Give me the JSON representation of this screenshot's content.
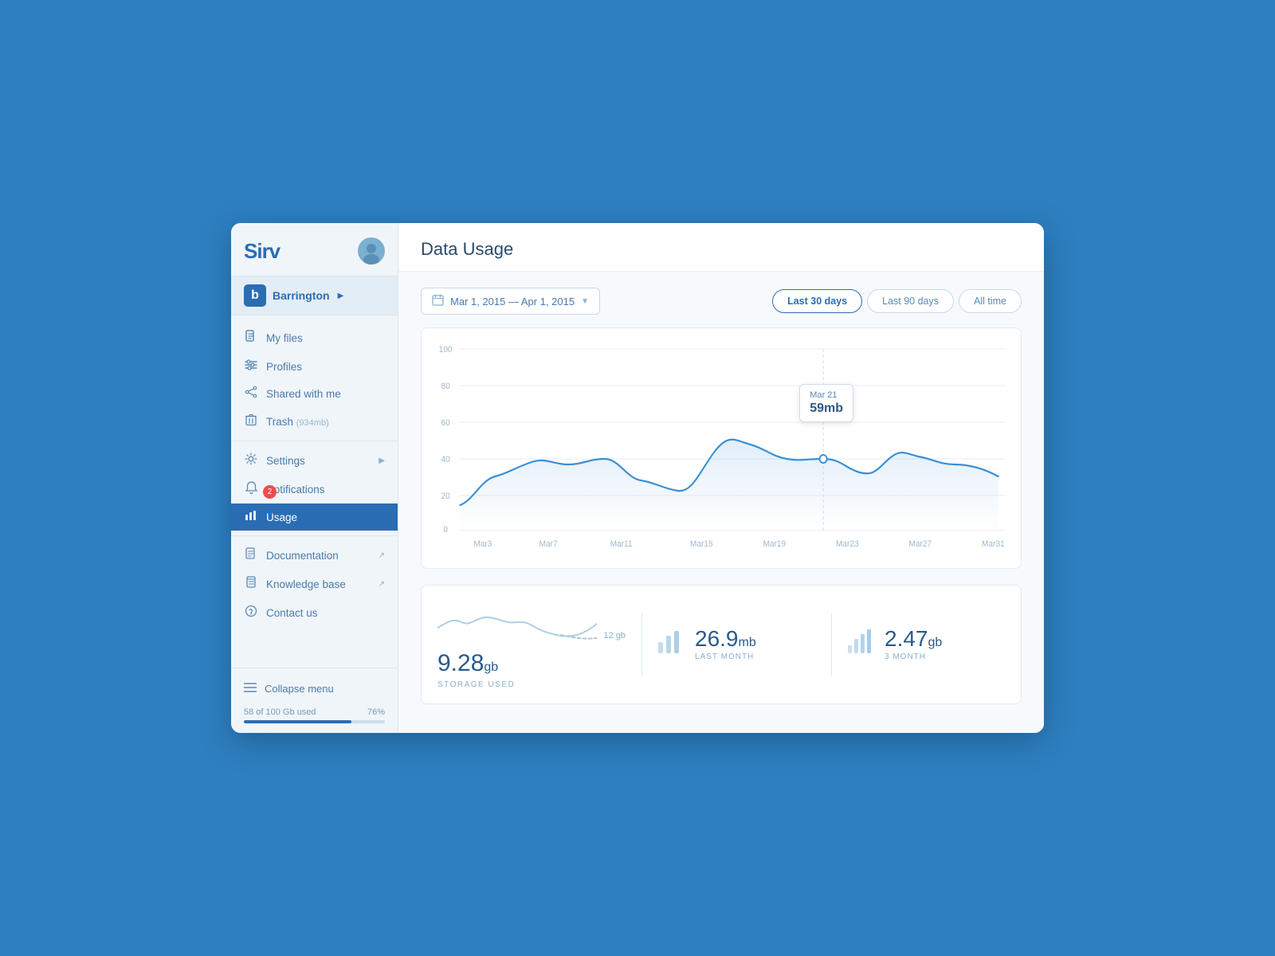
{
  "app": {
    "logo": "Sirv",
    "title": "Data Usage"
  },
  "sidebar": {
    "account": {
      "name": "Barrington",
      "arrow": "▶",
      "icon_letter": "b"
    },
    "nav_items": [
      {
        "id": "my-files",
        "label": "My files",
        "icon": "file",
        "active": false,
        "badge": null,
        "external": false
      },
      {
        "id": "profiles",
        "label": "Profiles",
        "icon": "sliders",
        "active": false,
        "badge": null,
        "external": false
      },
      {
        "id": "shared-with-me",
        "label": "Shared with me",
        "icon": "share",
        "active": false,
        "badge": null,
        "external": false
      },
      {
        "id": "trash",
        "label": "Trash",
        "icon": "trash",
        "active": false,
        "badge": null,
        "extra": "(934mb)",
        "external": false
      },
      {
        "id": "settings",
        "label": "Settings",
        "icon": "gear",
        "active": false,
        "badge": null,
        "arrow": "▶",
        "external": false
      },
      {
        "id": "notifications",
        "label": "Notifications",
        "icon": "bell",
        "active": false,
        "badge": "2",
        "external": false
      },
      {
        "id": "usage",
        "label": "Usage",
        "icon": "chart",
        "active": true,
        "badge": null,
        "external": false
      },
      {
        "id": "documentation",
        "label": "Documentation",
        "icon": "doc",
        "active": false,
        "badge": null,
        "external": true
      },
      {
        "id": "knowledge-base",
        "label": "Knowledge base",
        "icon": "book",
        "active": false,
        "badge": null,
        "external": true
      },
      {
        "id": "contact-us",
        "label": "Contact us",
        "icon": "help",
        "active": false,
        "badge": null,
        "external": false
      }
    ],
    "collapse_label": "Collapse menu",
    "storage": {
      "used_text": "58 of 100 Gb used",
      "percent_text": "76%",
      "percent": 76
    }
  },
  "controls": {
    "date_range": "Mar 1, 2015 — Apr 1, 2015",
    "period_buttons": [
      {
        "label": "Last 30 days",
        "active": true
      },
      {
        "label": "Last 90 days",
        "active": false
      },
      {
        "label": "All time",
        "active": false
      }
    ]
  },
  "chart": {
    "y_labels": [
      "100",
      "80",
      "60",
      "40",
      "20",
      "0"
    ],
    "x_labels": [
      "Mar3",
      "Mar7",
      "Mar11",
      "Mar15",
      "Mar19",
      "Mar23",
      "Mar27",
      "Mar31"
    ],
    "tooltip": {
      "date": "Mar 21",
      "value": "59mb"
    }
  },
  "stats": {
    "storage_used": "9.28",
    "storage_unit": "gb",
    "storage_label": "STORAGE USED",
    "sparkline_limit": "12 gb",
    "last_month_value": "26.9",
    "last_month_unit": "mb",
    "last_month_label": "LAST MONTH",
    "three_month_value": "2.47",
    "three_month_unit": "gb",
    "three_month_label": "3 MONTH"
  }
}
